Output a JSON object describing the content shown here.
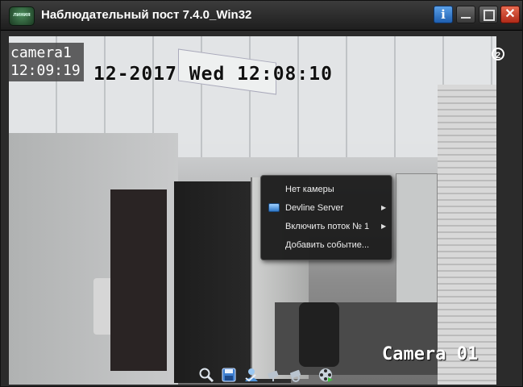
{
  "window": {
    "title": "Наблюдательный пост 7.4.0_Win32",
    "app_icon_text": "линия",
    "buttons": {
      "info": "i",
      "close": "✕"
    }
  },
  "video": {
    "camera_name": "camera1",
    "camera_time": "12:09:19",
    "osd_datetime": "12-2017 Wed 12:08:10",
    "osd_camera_label": "Camera 01",
    "stream_badge": "2"
  },
  "context_menu": {
    "items": [
      {
        "label": "Нет камеры",
        "icon": "",
        "submenu": false
      },
      {
        "label": "Devline Server",
        "icon": "server-icon",
        "submenu": true
      },
      {
        "label": "Включить поток № 1",
        "icon": "",
        "submenu": true
      },
      {
        "label": "Добавить событие...",
        "icon": "",
        "submenu": false
      }
    ]
  },
  "toolbar": {
    "items": [
      "zoom-icon",
      "save-icon",
      "user-icon",
      "camera-icon",
      "camera-icon",
      "film-icon"
    ]
  },
  "colors": {
    "accent_info": "#1f5fb0",
    "close_red": "#b02a18",
    "menu_bg": "#1c1c1c"
  }
}
